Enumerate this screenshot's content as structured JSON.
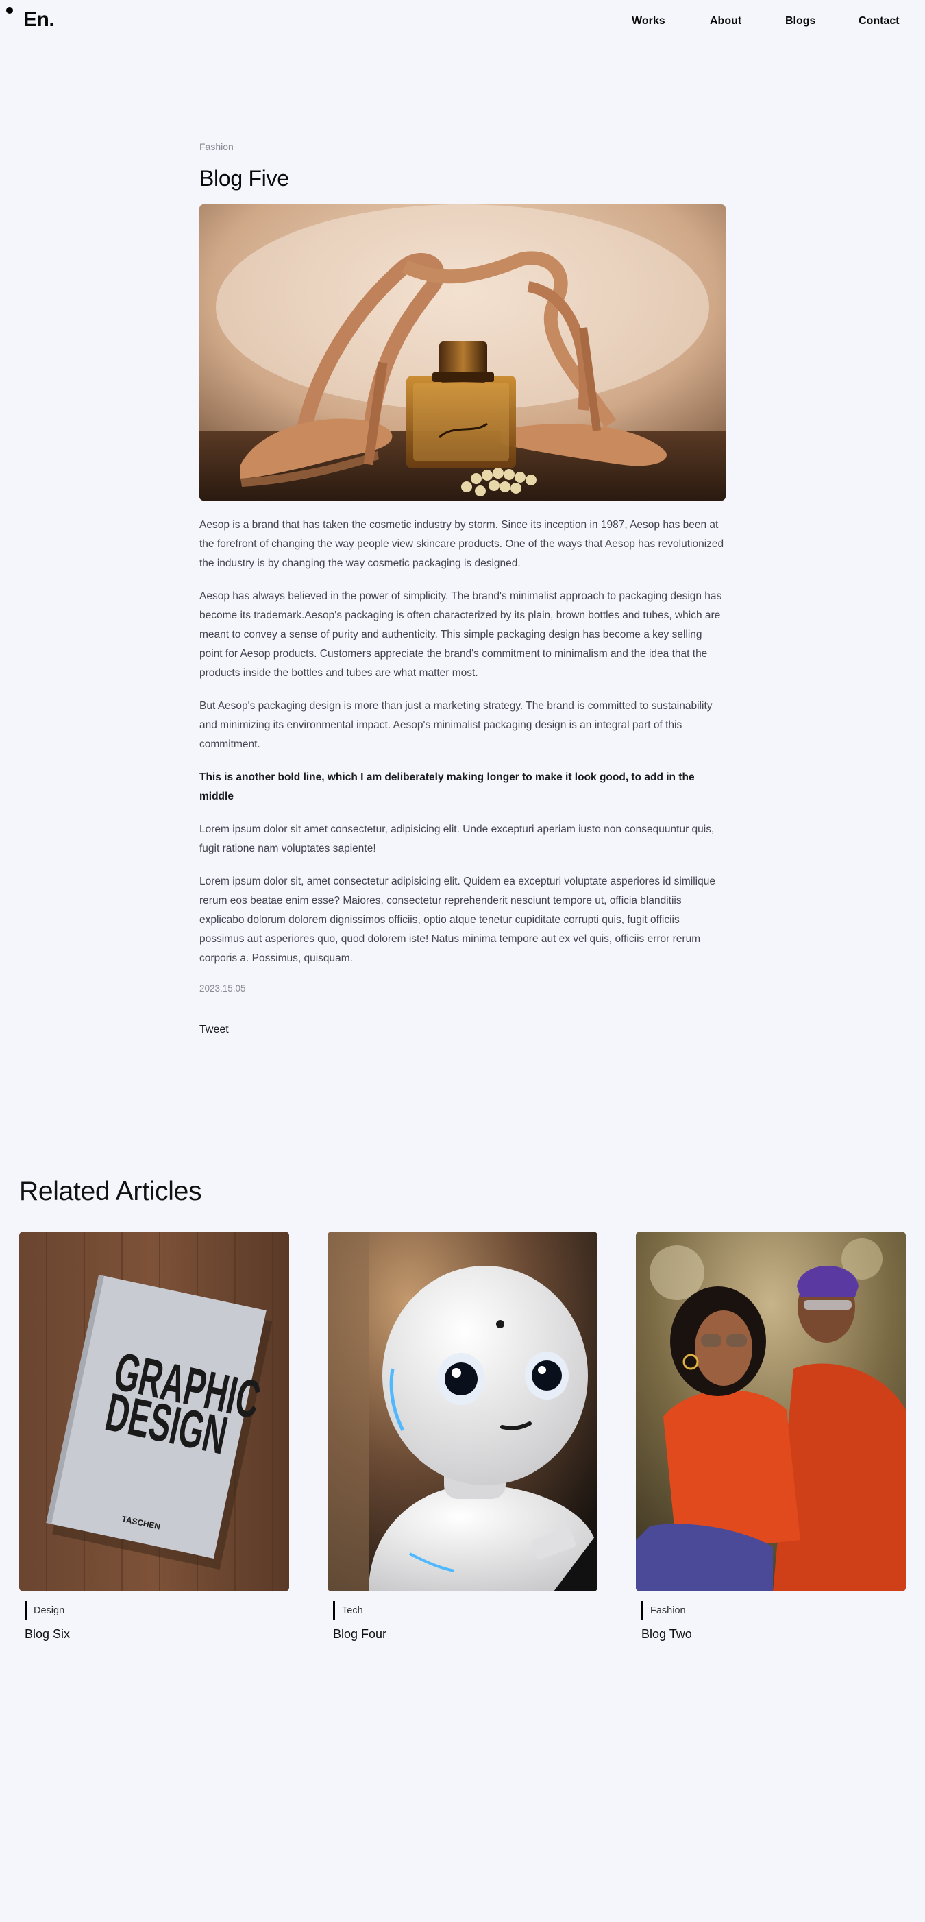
{
  "header": {
    "logo": "En.",
    "nav": [
      {
        "label": "Works"
      },
      {
        "label": "About"
      },
      {
        "label": "Blogs"
      },
      {
        "label": "Contact"
      }
    ]
  },
  "article": {
    "category": "Fashion",
    "title": "Blog Five",
    "hero_image": "perfume bottle in front of tan heeled sandals",
    "paragraphs": [
      "Aesop is a brand that has taken the cosmetic industry by storm. Since its inception in 1987, Aesop has been at the forefront of changing the way people view skincare products. One of the ways that Aesop has revolutionized the industry is by changing the way cosmetic packaging is designed.",
      "Aesop has always believed in the power of simplicity. The brand's minimalist approach to packaging design has become its trademark.Aesop's packaging is often characterized by its plain, brown bottles and tubes, which are meant to convey a sense of purity and authenticity. This simple packaging design has become a key selling point for Aesop products. Customers appreciate the brand's commitment to minimalism and the idea that the products inside the bottles and tubes are what matter most.",
      "But Aesop's packaging design is more than just a marketing strategy. The brand is committed to sustainability and minimizing its environmental impact. Aesop's minimalist packaging design is an integral part of this commitment."
    ],
    "bold_line": "This is another bold line, which I am deliberately making longer to make it look good, to add in the middle",
    "paragraphs_after": [
      "Lorem ipsum dolor sit amet consectetur, adipisicing elit. Unde excepturi aperiam iusto non consequuntur quis, fugit ratione nam voluptates sapiente!",
      "Lorem ipsum dolor sit, amet consectetur adipisicing elit. Quidem ea excepturi voluptate asperiores id similique rerum eos beatae enim esse? Maiores, consectetur reprehenderit nesciunt tempore ut, officia blanditiis explicabo dolorum dolorem dignissimos officiis, optio atque tenetur cupiditate corrupti quis, fugit officiis possimus aut asperiores quo, quod dolorem iste! Natus minima tempore aut ex vel quis, officiis error rerum corporis a. Possimus, quisquam."
    ],
    "date": "2023.15.05",
    "tweet": "Tweet"
  },
  "related": {
    "title": "Related Articles",
    "cards": [
      {
        "category": "Design",
        "title": "Blog Six",
        "image": "graphic-design-book",
        "book_line1": "GRAPHIC",
        "book_line2": "DESIGN",
        "book_publisher": "TASCHEN"
      },
      {
        "category": "Tech",
        "title": "Blog Four",
        "image": "white-robot"
      },
      {
        "category": "Fashion",
        "title": "Blog Two",
        "image": "two-people-in-red-shirts"
      }
    ]
  },
  "colors": {
    "background": "#f5f5fc",
    "text": "#111111",
    "muted": "#8a8a94",
    "body_text": "#454550"
  }
}
